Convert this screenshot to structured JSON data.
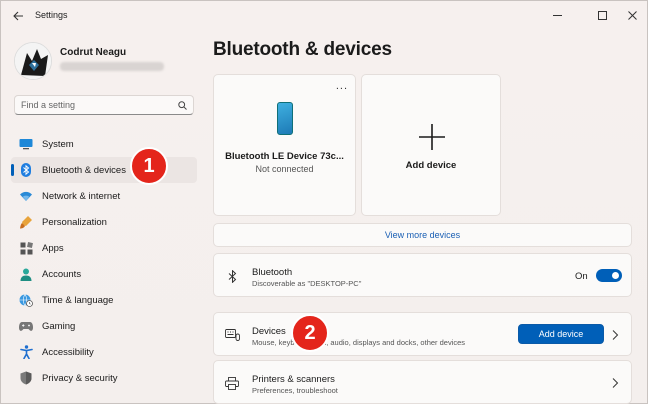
{
  "window": {
    "title": "Settings"
  },
  "profile": {
    "name": "Codrut Neagu"
  },
  "search": {
    "placeholder": "Find a setting"
  },
  "sidebar": {
    "items": [
      {
        "label": "System",
        "icon": "monitor-icon"
      },
      {
        "label": "Bluetooth & devices",
        "icon": "bluetooth-icon",
        "selected": true
      },
      {
        "label": "Network & internet",
        "icon": "wifi-icon"
      },
      {
        "label": "Personalization",
        "icon": "brush-icon"
      },
      {
        "label": "Apps",
        "icon": "apps-icon"
      },
      {
        "label": "Accounts",
        "icon": "person-icon"
      },
      {
        "label": "Time & language",
        "icon": "globe-clock-icon"
      },
      {
        "label": "Gaming",
        "icon": "gamepad-icon"
      },
      {
        "label": "Accessibility",
        "icon": "accessibility-icon"
      },
      {
        "label": "Privacy & security",
        "icon": "shield-icon"
      }
    ]
  },
  "main": {
    "title": "Bluetooth & devices",
    "device_card": {
      "name": "Bluetooth LE Device 73c...",
      "status": "Not connected",
      "more": "..."
    },
    "add_card": {
      "label": "Add device"
    },
    "view_more": "View more devices",
    "bluetooth_row": {
      "title": "Bluetooth",
      "subtitle": "Discoverable as \"DESKTOP-PC\"",
      "toggle_label": "On",
      "toggle_on": true
    },
    "devices_row": {
      "title": "Devices",
      "subtitle": "Mouse, keyboard, pen, audio, displays and docks, other devices",
      "button": "Add device"
    },
    "printers_row": {
      "title": "Printers & scanners",
      "subtitle": "Preferences, troubleshoot"
    }
  },
  "annotations": {
    "badge1": "1",
    "badge2": "2"
  },
  "colors": {
    "accent": "#005fb8",
    "badge": "#e4251b"
  }
}
